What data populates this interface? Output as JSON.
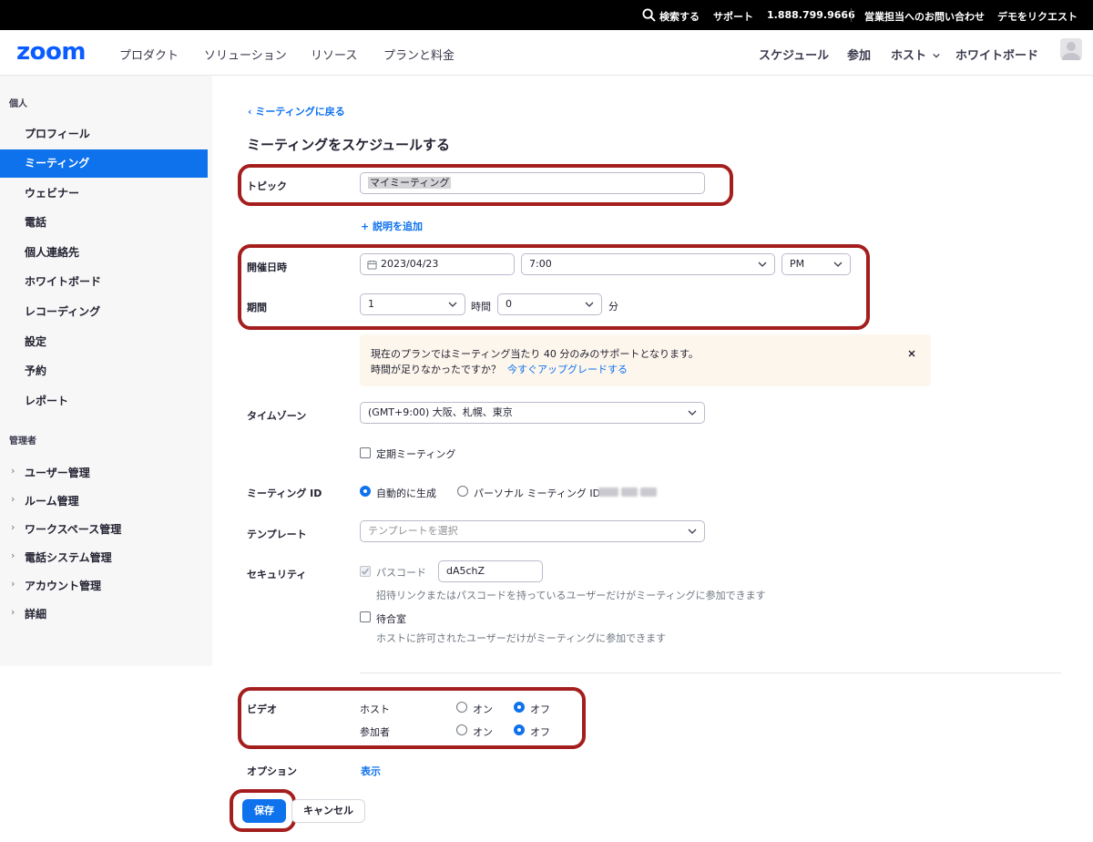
{
  "topbar": {
    "search": "検索する",
    "support": "サポート",
    "phone": "1.888.799.9666",
    "contact_sales": "営業担当へのお問い合わせ",
    "request_demo": "デモをリクエスト"
  },
  "header": {
    "logo": "zoom",
    "nav": [
      "プロダクト",
      "ソリューション",
      "リソース",
      "プランと料金"
    ],
    "right": {
      "schedule": "スケジュール",
      "join": "参加",
      "host": "ホスト",
      "whiteboard": "ホワイトボード"
    }
  },
  "sidebar": {
    "personal_heading": "個人",
    "items": [
      "プロフィール",
      "ミーティング",
      "ウェビナー",
      "電話",
      "個人連絡先",
      "ホワイトボード",
      "レコーディング",
      "設定",
      "予約",
      "レポート"
    ],
    "active_index": 1,
    "admin_heading": "管理者",
    "admin_items": [
      "ユーザー管理",
      "ルーム管理",
      "ワークスペース管理",
      "電話システム管理",
      "アカウント管理",
      "詳細"
    ]
  },
  "main": {
    "back_link": "ミーティングに戻る",
    "title": "ミーティングをスケジュールする",
    "topic": {
      "label": "トピック",
      "value": "マイミーティング"
    },
    "add_description": "説明を追加",
    "when": {
      "label": "開催日時",
      "date": "2023/04/23",
      "time": "7:00",
      "ampm": "PM"
    },
    "duration": {
      "label": "期間",
      "hours": "1",
      "hours_unit": "時間",
      "minutes": "0",
      "minutes_unit": "分"
    },
    "notice": {
      "line1": "現在のプランではミーティング当たり 40 分のみのサポートとなります。",
      "line2": "時間が足りなかったですか？",
      "upgrade": "今すぐアップグレードする"
    },
    "timezone": {
      "label": "タイムゾーン",
      "value": "(GMT+9:00) 大阪、札幌、東京"
    },
    "recurring": "定期ミーティング",
    "meeting_id": {
      "label": "ミーティング ID",
      "auto": "自動的に生成",
      "personal": "パーソナル ミーティング ID"
    },
    "template": {
      "label": "テンプレート",
      "placeholder": "テンプレートを選択"
    },
    "security": {
      "label": "セキュリティ",
      "passcode_label": "パスコード",
      "passcode": "dA5chZ",
      "passcode_hint": "招待リンクまたはパスコードを持っているユーザーだけがミーティングに参加できます",
      "waiting_room": "待合室",
      "waiting_hint": "ホストに許可されたユーザーだけがミーティングに参加できます"
    },
    "video": {
      "label": "ビデオ",
      "host": "ホスト",
      "participant": "参加者",
      "on": "オン",
      "off": "オフ"
    },
    "options": {
      "label": "オプション",
      "show": "表示"
    },
    "save": "保存",
    "cancel": "キャンセル"
  },
  "colors": {
    "accent": "#0e72ed",
    "highlight": "#a51e1e",
    "notice_bg": "#fdf6ec"
  }
}
